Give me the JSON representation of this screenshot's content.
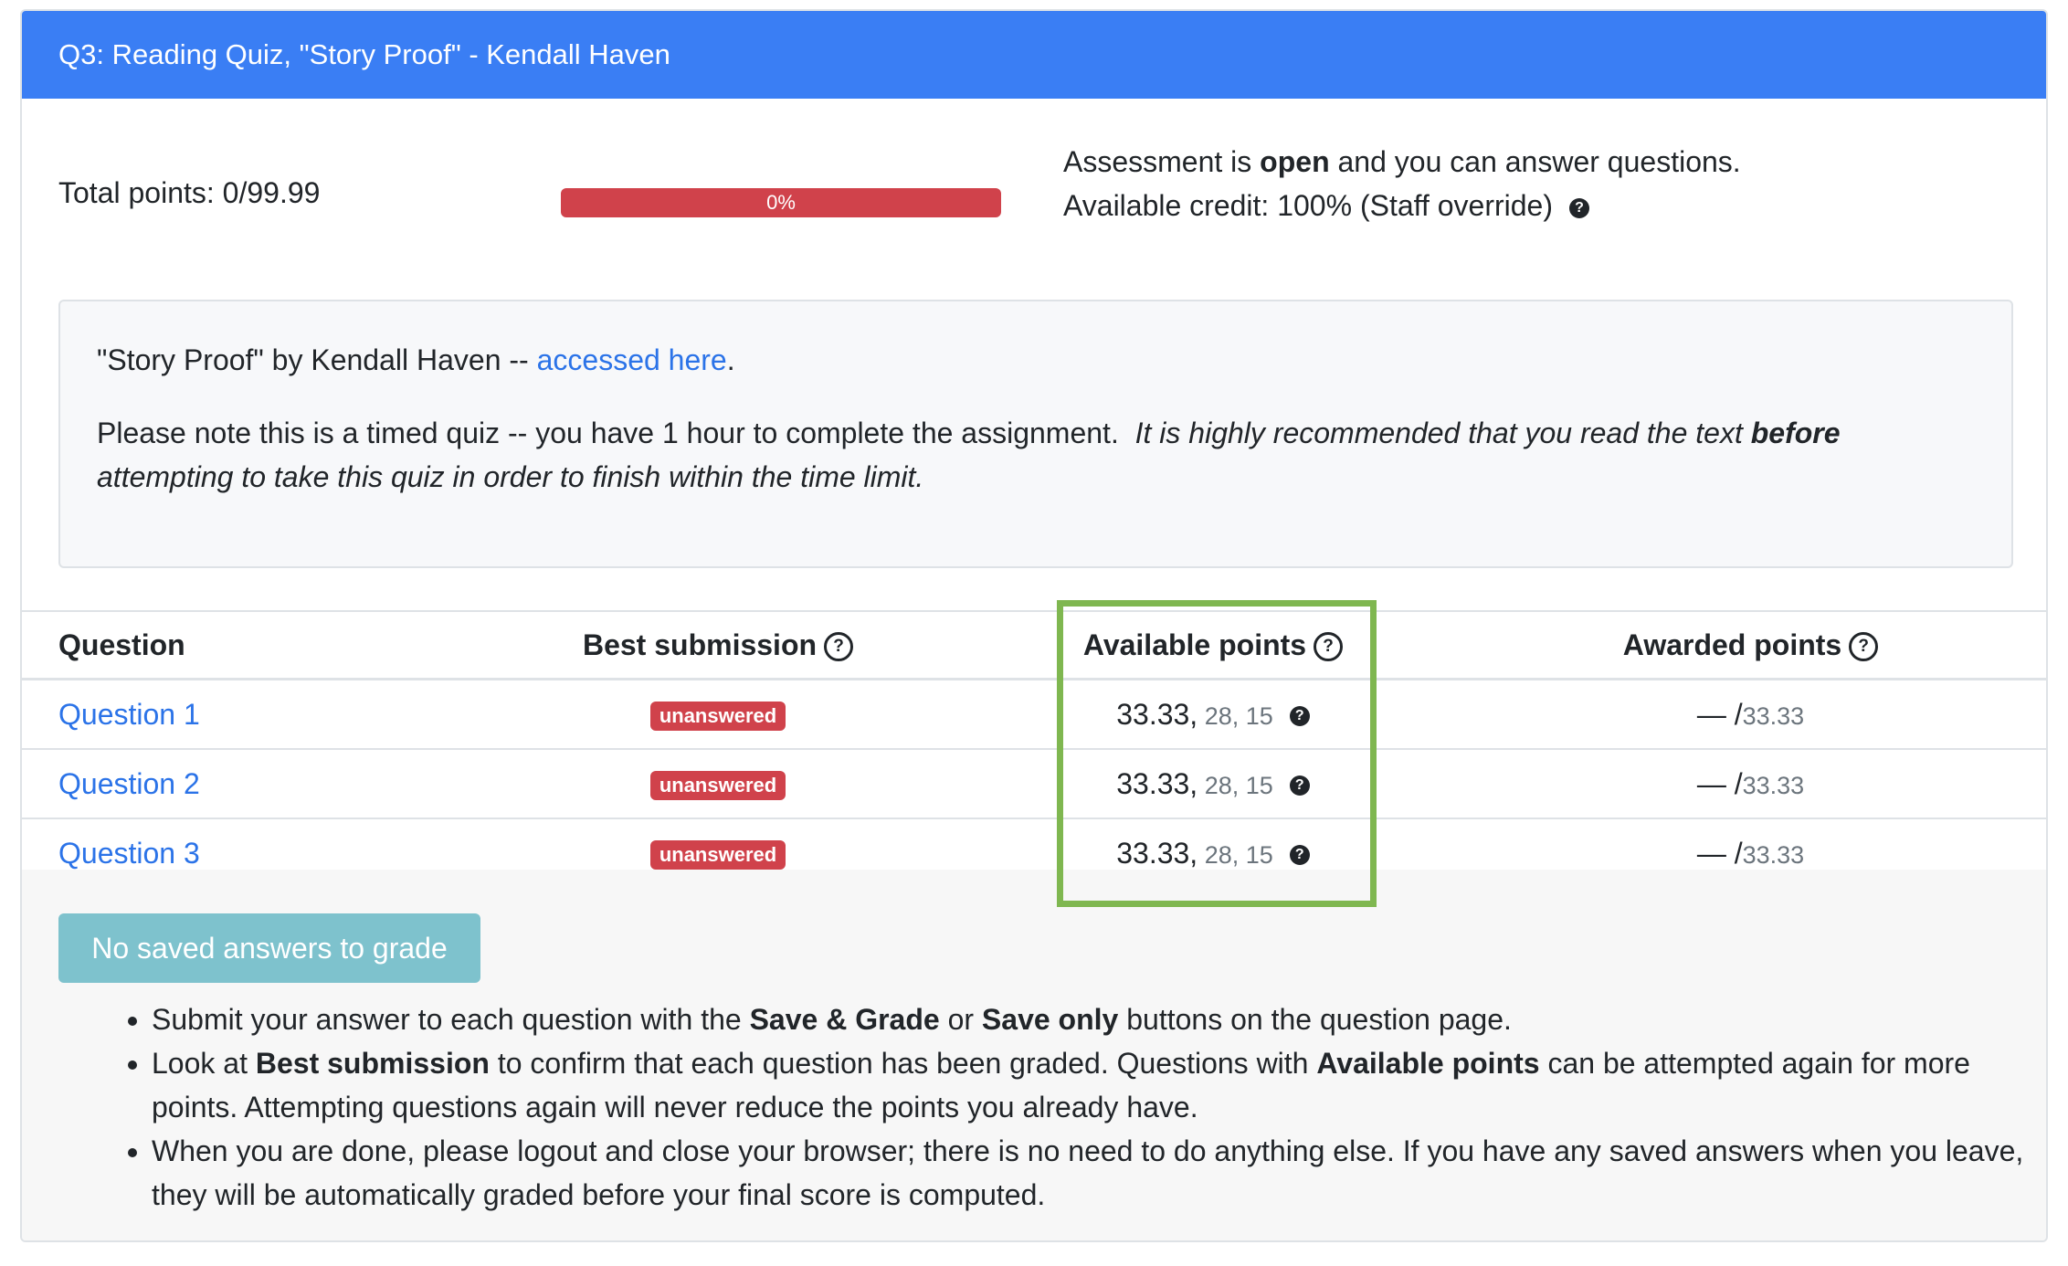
{
  "header": {
    "title": "Q3: Reading Quiz, \"Story Proof\" - Kendall Haven"
  },
  "summary": {
    "total_points_label": "Total points: 0/99.99",
    "progress_label": "0%",
    "progress_fraction": 0,
    "status_prefix": "Assessment is ",
    "status_bold": "open",
    "status_suffix": " and you can answer questions.",
    "credit": "Available credit: 100% (Staff override)",
    "help_glyph": "?"
  },
  "info": {
    "line1_prefix": "\"Story Proof\" by Kendall Haven -- ",
    "line1_link": "accessed here",
    "line1_suffix": ".",
    "line2_plain": "Please note this is a timed quiz -- you have 1 hour to complete the assignment.  ",
    "line2_italic_a": "It is highly recommended that you read the text ",
    "line2_italic_bold": "before",
    "line2_italic_b": " attempting to take this quiz in order to finish within the time limit."
  },
  "table": {
    "headers": [
      "Question",
      "Best submission",
      "Available points",
      "Awarded points"
    ],
    "header_help_glyph": "?",
    "rows": [
      {
        "question": "Question 1",
        "status": "unanswered",
        "points_main": "33.33,",
        "points_more": " 28, 15",
        "awarded_dash": "— /",
        "awarded_max": "33.33"
      },
      {
        "question": "Question 2",
        "status": "unanswered",
        "points_main": "33.33,",
        "points_more": " 28, 15",
        "awarded_dash": "— /",
        "awarded_max": "33.33"
      },
      {
        "question": "Question 3",
        "status": "unanswered",
        "points_main": "33.33,",
        "points_more": " 28, 15",
        "awarded_dash": "— /",
        "awarded_max": "33.33"
      }
    ]
  },
  "footer": {
    "grade_button": "No saved answers to grade",
    "tip1": [
      "Submit your answer to each question with the ",
      "Save & Grade",
      " or ",
      "Save only",
      " buttons on the question page."
    ],
    "tip2": [
      "Look at ",
      "Best submission",
      " to confirm that each question has been graded. Questions with ",
      "Available points",
      " can be attempted again for more points. Attempting questions again will never reduce the points you already have."
    ],
    "tip3": "When you are done, please logout and close your browser; there is no need to do anything else. If you have any saved answers when you leave, they will be automatically graded before your final score is computed."
  },
  "colors": {
    "header": "#3a7ef4",
    "danger": "#d0424b",
    "link": "#2b73e8",
    "highlight": "#7fb750",
    "grade_button": "#7ec2cd"
  }
}
